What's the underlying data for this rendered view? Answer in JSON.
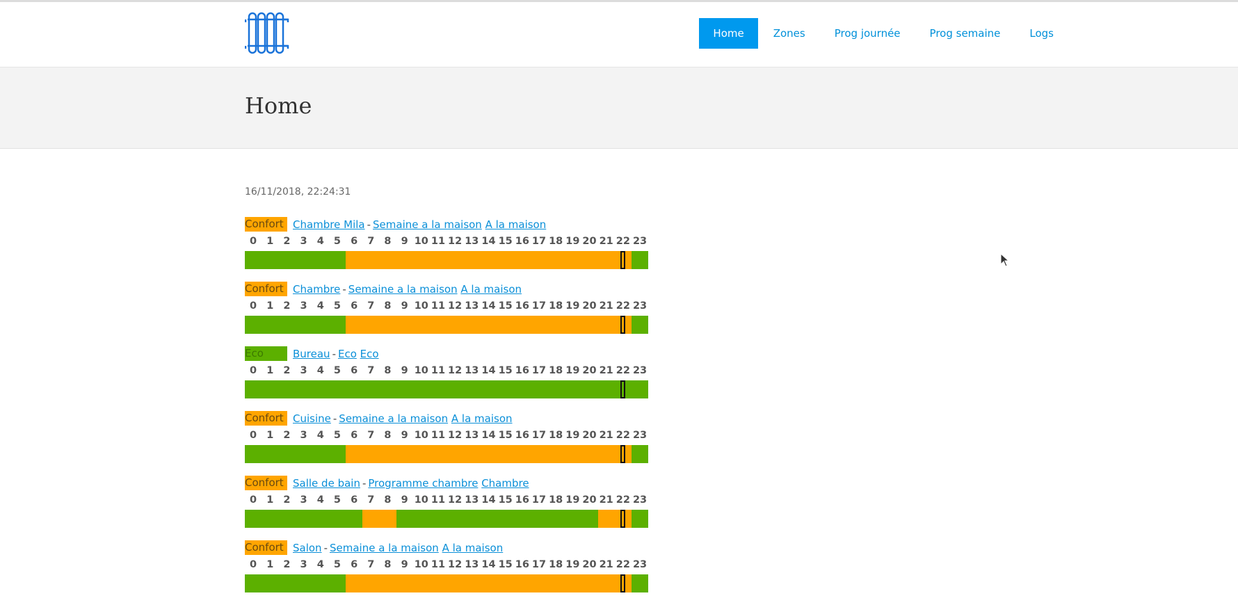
{
  "nav": {
    "logo_icon": "radiator-icon",
    "items": [
      {
        "label": "Home",
        "active": true
      },
      {
        "label": "Zones",
        "active": false
      },
      {
        "label": "Prog journée",
        "active": false
      },
      {
        "label": "Prog semaine",
        "active": false
      },
      {
        "label": "Logs",
        "active": false
      }
    ]
  },
  "page": {
    "title": "Home",
    "datetime": "16/11/2018, 22:24:31"
  },
  "colors": {
    "confort": "#ffa500",
    "eco": "#5cb000",
    "accent": "#0099ee"
  },
  "hours": [
    "0",
    "1",
    "2",
    "3",
    "4",
    "5",
    "6",
    "7",
    "8",
    "9",
    "10",
    "11",
    "12",
    "13",
    "14",
    "15",
    "16",
    "17",
    "18",
    "19",
    "20",
    "21",
    "22",
    "23"
  ],
  "current_hour": "22",
  "zones": [
    {
      "mode": "Confort",
      "name": "Chambre Mila",
      "sep": "-",
      "program": "Semaine a la maison",
      "day_program": "A la maison",
      "schedule": [
        "eco",
        "eco",
        "eco",
        "eco",
        "eco",
        "eco",
        "confort",
        "confort",
        "confort",
        "confort",
        "confort",
        "confort",
        "confort",
        "confort",
        "confort",
        "confort",
        "confort",
        "confort",
        "confort",
        "confort",
        "confort",
        "confort",
        "confort",
        "eco"
      ]
    },
    {
      "mode": "Confort",
      "name": "Chambre",
      "sep": "-",
      "program": "Semaine a la maison",
      "day_program": "A la maison",
      "schedule": [
        "eco",
        "eco",
        "eco",
        "eco",
        "eco",
        "eco",
        "confort",
        "confort",
        "confort",
        "confort",
        "confort",
        "confort",
        "confort",
        "confort",
        "confort",
        "confort",
        "confort",
        "confort",
        "confort",
        "confort",
        "confort",
        "confort",
        "confort",
        "eco"
      ]
    },
    {
      "mode": "Eco",
      "name": "Bureau",
      "sep": "-",
      "program": "Eco",
      "day_program": "Eco",
      "schedule": [
        "eco",
        "eco",
        "eco",
        "eco",
        "eco",
        "eco",
        "eco",
        "eco",
        "eco",
        "eco",
        "eco",
        "eco",
        "eco",
        "eco",
        "eco",
        "eco",
        "eco",
        "eco",
        "eco",
        "eco",
        "eco",
        "eco",
        "eco",
        "eco"
      ]
    },
    {
      "mode": "Confort",
      "name": "Cuisine",
      "sep": "-",
      "program": "Semaine a la maison",
      "day_program": "A la maison",
      "schedule": [
        "eco",
        "eco",
        "eco",
        "eco",
        "eco",
        "eco",
        "confort",
        "confort",
        "confort",
        "confort",
        "confort",
        "confort",
        "confort",
        "confort",
        "confort",
        "confort",
        "confort",
        "confort",
        "confort",
        "confort",
        "confort",
        "confort",
        "confort",
        "eco"
      ]
    },
    {
      "mode": "Confort",
      "name": "Salle de bain",
      "sep": "-",
      "program": "Programme chambre",
      "day_program": "Chambre",
      "schedule": [
        "eco",
        "eco",
        "eco",
        "eco",
        "eco",
        "eco",
        "eco",
        "confort",
        "confort",
        "eco",
        "eco",
        "eco",
        "eco",
        "eco",
        "eco",
        "eco",
        "eco",
        "eco",
        "eco",
        "eco",
        "eco",
        "confort",
        "confort",
        "eco"
      ]
    },
    {
      "mode": "Confort",
      "name": "Salon",
      "sep": "-",
      "program": "Semaine a la maison",
      "day_program": "A la maison",
      "schedule": [
        "eco",
        "eco",
        "eco",
        "eco",
        "eco",
        "eco",
        "confort",
        "confort",
        "confort",
        "confort",
        "confort",
        "confort",
        "confort",
        "confort",
        "confort",
        "confort",
        "confort",
        "confort",
        "confort",
        "confort",
        "confort",
        "confort",
        "confort",
        "eco"
      ]
    }
  ]
}
